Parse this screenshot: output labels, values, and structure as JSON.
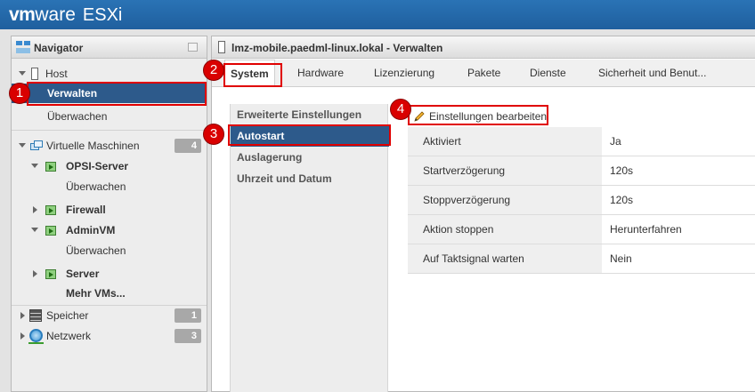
{
  "header": {
    "logo_vm": "vm",
    "logo_ware": "ware",
    "logo_product": "ESXi"
  },
  "navigator": {
    "title": "Navigator",
    "host": {
      "label": "Host",
      "children": [
        "Verwalten",
        "Überwachen"
      ]
    },
    "vms": {
      "label": "Virtuelle Maschinen",
      "count": "4",
      "items": [
        {
          "label": "OPSI-Server",
          "child": "Überwachen"
        },
        {
          "label": "Firewall"
        },
        {
          "label": "AdminVM",
          "child": "Überwachen"
        },
        {
          "label": "Server"
        }
      ],
      "more": "Mehr VMs..."
    },
    "storage": {
      "label": "Speicher",
      "count": "1"
    },
    "network": {
      "label": "Netzwerk",
      "count": "3"
    }
  },
  "main": {
    "title": "lmz-mobile.paedml-linux.lokal - Verwalten",
    "tabs": [
      "System",
      "Hardware",
      "Lizenzierung",
      "Pakete",
      "Dienste",
      "Sicherheit und Benut..."
    ],
    "menu": [
      "Erweiterte Einstellungen",
      "Autostart",
      "Auslagerung",
      "Uhrzeit und Datum"
    ],
    "edit_button": "Einstellungen bearbeiten",
    "settings": [
      {
        "key": "Aktiviert",
        "value": "Ja"
      },
      {
        "key": "Startverzögerung",
        "value": "120s"
      },
      {
        "key": "Stoppverzögerung",
        "value": "120s"
      },
      {
        "key": "Aktion stoppen",
        "value": "Herunterfahren"
      },
      {
        "key": "Auf Taktsignal warten",
        "value": "Nein"
      }
    ]
  },
  "annotations": [
    "1",
    "2",
    "3",
    "4"
  ],
  "colors": {
    "header_blue": "#1f5f9e",
    "selection": "#2d5a8b",
    "callout_red": "#d90000"
  }
}
